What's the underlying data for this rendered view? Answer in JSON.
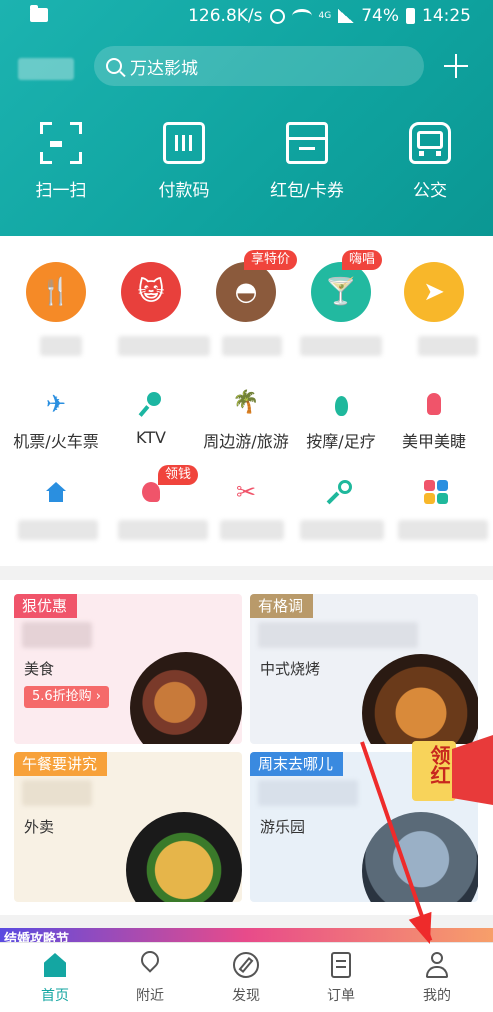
{
  "status_bar": {
    "network_speed": "126.8K/s",
    "signal_label": "4G",
    "battery": "74%",
    "time": "14:25"
  },
  "header": {
    "search_text": "万达影城",
    "top_functions": [
      {
        "label": "扫一扫",
        "icon": "scan-icon"
      },
      {
        "label": "付款码",
        "icon": "payment-code-icon"
      },
      {
        "label": "红包/卡券",
        "icon": "coupon-icon"
      },
      {
        "label": "公交",
        "icon": "bus-icon"
      }
    ]
  },
  "categories": {
    "badges": [
      "享特价",
      "嗨唱",
      "领钱"
    ],
    "row2": [
      {
        "label": "机票/火车票",
        "icon": "plane-icon"
      },
      {
        "label": "KTV",
        "icon": "microphone-icon"
      },
      {
        "label": "周边游/旅游",
        "icon": "palm-tree-icon"
      },
      {
        "label": "按摩/足疗",
        "icon": "foot-icon"
      },
      {
        "label": "美甲美睫",
        "icon": "nail-icon"
      }
    ]
  },
  "promos": [
    {
      "tag": "狠优惠",
      "title": "美食",
      "pill": "5.6折抢购 ›"
    },
    {
      "tag": "有格调",
      "title": "中式烧烤"
    },
    {
      "tag": "午餐要讲究",
      "title": "外卖"
    },
    {
      "tag": "周末去哪儿",
      "title": "游乐园"
    }
  ],
  "bottom_banner": "结婚攻略节",
  "red_envelope": "领红",
  "tabs": [
    {
      "label": "首页",
      "icon": "home-icon",
      "active": true
    },
    {
      "label": "附近",
      "icon": "location-pin-icon"
    },
    {
      "label": "发现",
      "icon": "compass-icon"
    },
    {
      "label": "订单",
      "icon": "order-list-icon"
    },
    {
      "label": "我的",
      "icon": "profile-icon"
    }
  ],
  "colors": {
    "brand": "#14a6a2",
    "badge_red": "#f0443c",
    "arrow_red": "#ee2b2b"
  }
}
